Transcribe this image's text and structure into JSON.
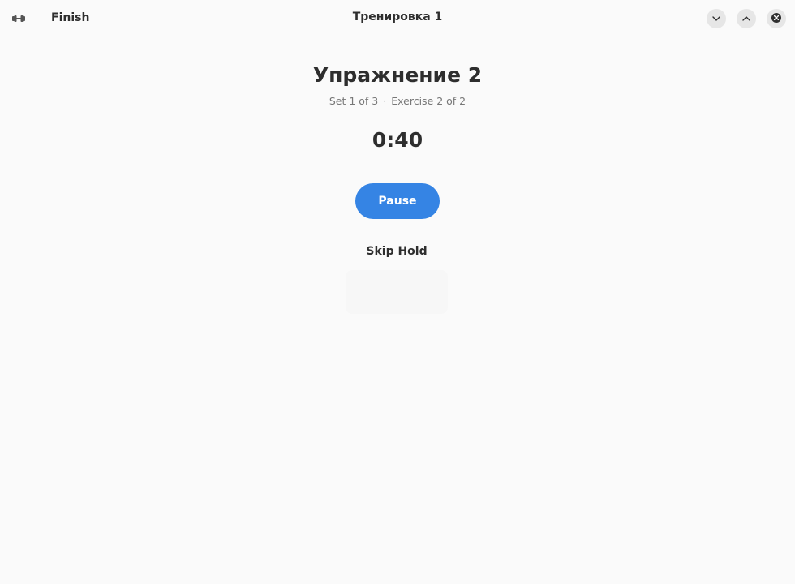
{
  "window": {
    "title": "Тренировка 1"
  },
  "header": {
    "app_icon": "dumbbell-icon",
    "finish_label": "Finish",
    "controls": {
      "minimize_icon": "chevron-down-icon",
      "maximize_icon": "chevron-up-icon",
      "close_icon": "close-icon"
    }
  },
  "workout": {
    "exercise_title": "Упражнение 2",
    "set_text": "Set 1 of 3",
    "separator": "·",
    "exercise_text": "Exercise 2 of 2",
    "timer": "0:40",
    "pause_label": "Pause",
    "skip_label": "Skip Hold"
  },
  "colors": {
    "accent": "#3584e4",
    "background": "#fafafa",
    "text": "#2e2e2e",
    "dim_text": "#777777"
  }
}
